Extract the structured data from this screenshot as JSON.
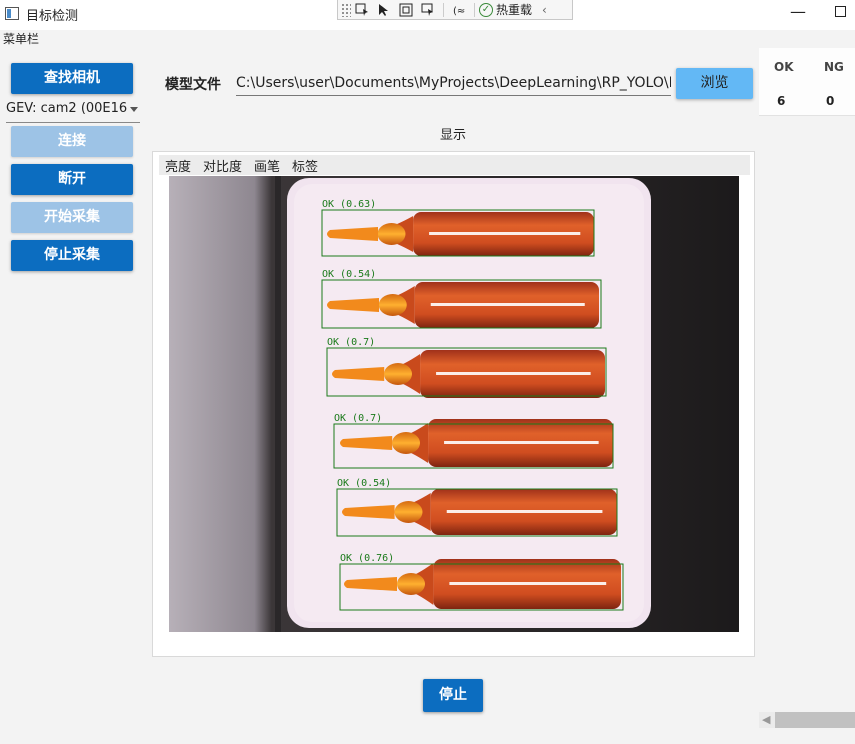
{
  "window": {
    "title": "目标检测",
    "minimize_glyph": "—"
  },
  "debug_toolbar": {
    "hot_reload_label": "热重载",
    "icons": [
      "live-visual-tree-icon",
      "select-element-icon",
      "display-layout-adorners-icon",
      "track-focused-element-icon",
      "binding-failures-icon",
      "hot-reload-check-icon",
      "collapse-toolbar-icon"
    ]
  },
  "menubar": {
    "label": "菜单栏"
  },
  "left_panel": {
    "find_camera": "查找相机",
    "camera_select": "GEV: cam2 (00E16",
    "connect": "连接",
    "disconnect": "断开",
    "start_capture": "开始采集",
    "stop_capture": "停止采集"
  },
  "model": {
    "label": "模型文件",
    "path": "C:\\Users\\user\\Documents\\MyProjects\\DeepLearning\\RP_YOLO\\RP_YOLO\\model",
    "browse": "浏览"
  },
  "stats": {
    "ok_header": "OK",
    "ng_header": "NG",
    "ok_count": "6",
    "ng_count": "0"
  },
  "display": {
    "label": "显示",
    "toolbar": {
      "brightness": "亮度",
      "contrast": "对比度",
      "brush": "画笔",
      "annotate": "标签"
    }
  },
  "detections": [
    {
      "label": "OK (0.63)"
    },
    {
      "label": "OK (0.54)"
    },
    {
      "label": "OK (0.7)"
    },
    {
      "label": "OK (0.7)"
    },
    {
      "label": "OK (0.54)"
    },
    {
      "label": "OK (0.76)"
    }
  ],
  "bottom": {
    "stop": "停止"
  },
  "colors": {
    "primary": "#0c6dc0",
    "primary_disabled": "#9dc3e6",
    "browse": "#63b8f5",
    "detection_box": "#1a7a1a",
    "ampoule": "#d2541b"
  }
}
